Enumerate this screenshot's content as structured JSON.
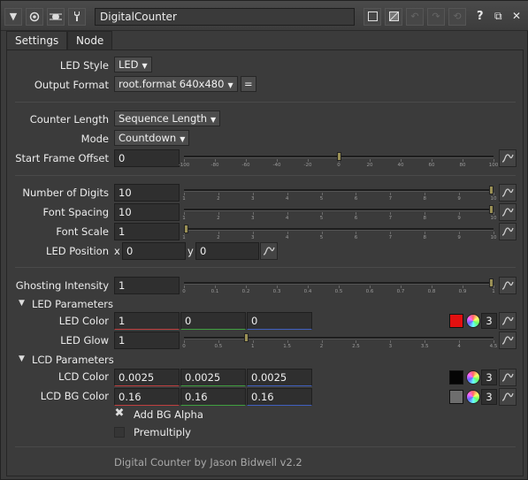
{
  "header": {
    "node_name": "DigitalCounter",
    "help": "?",
    "float": "⧉",
    "close": "✕"
  },
  "tabs": [
    {
      "label": "Settings"
    },
    {
      "label": "Node"
    }
  ],
  "params": {
    "led_style": {
      "label": "LED Style",
      "value": "LED"
    },
    "output_format": {
      "label": "Output Format",
      "value": "root.format 640x480",
      "eq": "="
    },
    "counter_length": {
      "label": "Counter Length",
      "value": "Sequence Length"
    },
    "mode": {
      "label": "Mode",
      "value": "Countdown"
    },
    "start_frame_offset": {
      "label": "Start Frame Offset",
      "value": "0",
      "ticks": [
        "-100",
        "-80",
        "-60",
        "-40",
        "-20",
        "0",
        "20",
        "40",
        "60",
        "80",
        "100"
      ],
      "position": 0.5
    },
    "number_of_digits": {
      "label": "Number of Digits",
      "value": "10",
      "ticks": [
        "1",
        "2",
        "3",
        "4",
        "5",
        "6",
        "7",
        "8",
        "9",
        "10"
      ],
      "position": 1.0
    },
    "font_spacing": {
      "label": "Font Spacing",
      "value": "10",
      "ticks": [
        "1",
        "2",
        "3",
        "4",
        "5",
        "6",
        "7",
        "8",
        "9",
        "10"
      ],
      "position": 1.0
    },
    "font_scale": {
      "label": "Font Scale",
      "value": "1",
      "ticks": [
        "1",
        "2",
        "3",
        "4",
        "5",
        "6",
        "7",
        "8",
        "9",
        "10"
      ],
      "position": 0.0
    },
    "led_position": {
      "label": "LED Position",
      "x_label": "x",
      "x": "0",
      "y_label": "y",
      "y": "0"
    },
    "ghosting_intensity": {
      "label": "Ghosting Intensity",
      "value": "1",
      "ticks": [
        "0",
        "0.1",
        "0.2",
        "0.3",
        "0.4",
        "0.5",
        "0.6",
        "0.7",
        "0.8",
        "0.9",
        "1"
      ],
      "position": 1.0
    }
  },
  "led_section": {
    "title": "LED Parameters",
    "led_color": {
      "label": "LED Color",
      "r": "1",
      "g": "0",
      "b": "0",
      "swatch": "#e31010",
      "channels": "3"
    },
    "led_glow": {
      "label": "LED Glow",
      "value": "1",
      "ticks": [
        "0",
        "0.5",
        "1",
        "1.5",
        "2",
        "2.5",
        "3",
        "3.5",
        "4",
        "4.5"
      ],
      "position": 0.2
    }
  },
  "lcd_section": {
    "title": "LCD Parameters",
    "lcd_color": {
      "label": "LCD Color",
      "r": "0.0025",
      "g": "0.0025",
      "b": "0.0025",
      "swatch": "#050505",
      "channels": "3"
    },
    "lcd_bg_color": {
      "label": "LCD BG Color",
      "r": "0.16",
      "g": "0.16",
      "b": "0.16",
      "swatch": "#6e6e6e",
      "channels": "3"
    },
    "add_bg_alpha": {
      "label": "Add BG Alpha",
      "checked": true,
      "mark": "✖"
    },
    "premultiply": {
      "label": "Premultiply",
      "checked": false
    }
  },
  "footer": {
    "credit": "Digital Counter by Jason Bidwell v2.2"
  }
}
